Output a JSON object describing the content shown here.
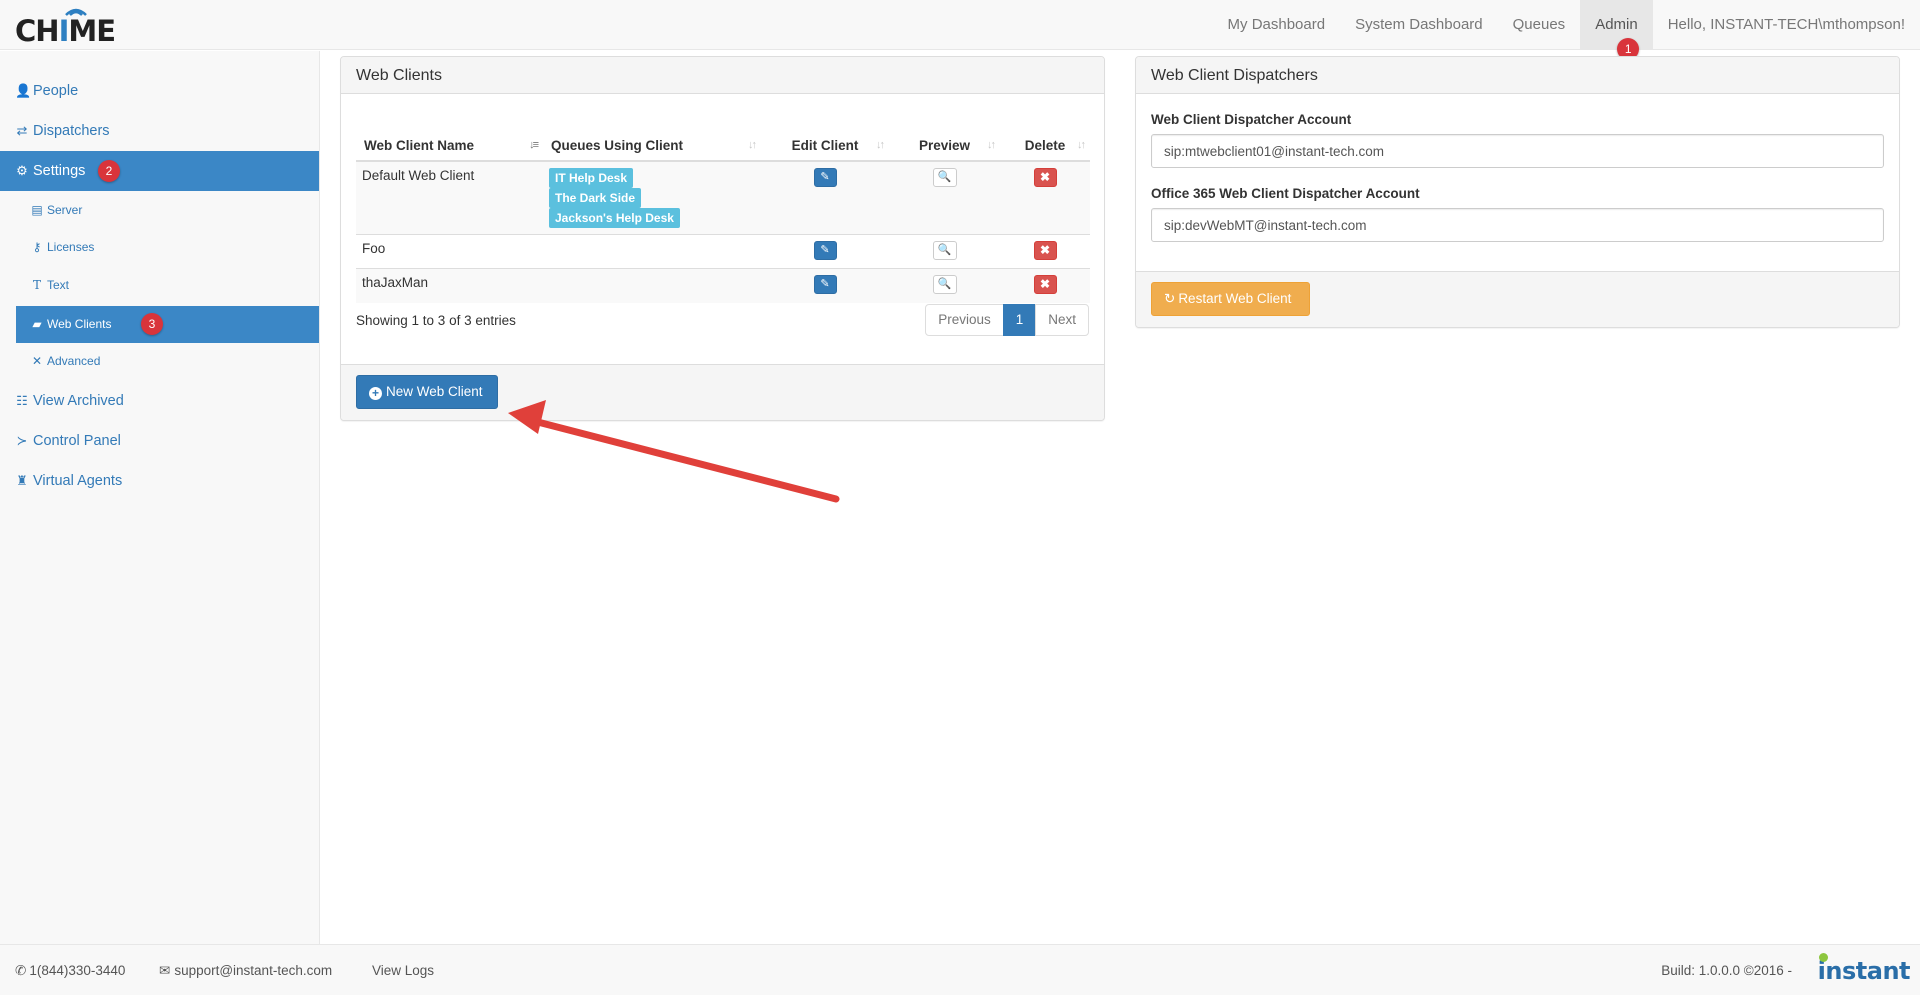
{
  "app": {
    "logo_text": "CHIME",
    "logo_pre": "CH",
    "logo_i": "I",
    "logo_post": "ME"
  },
  "navbar": {
    "links": [
      "My Dashboard",
      "System Dashboard",
      "Queues",
      "Admin"
    ],
    "greeting": "Hello, INSTANT-TECH\\mthompson!",
    "admin_badge": "1"
  },
  "sidebar": {
    "items": [
      {
        "label": "People",
        "icon": "user-icon"
      },
      {
        "label": "Dispatchers",
        "icon": "exchange-icon"
      },
      {
        "label": "Settings",
        "icon": "gear-icon",
        "badge": "2"
      },
      {
        "label": "Server",
        "icon": "server-icon"
      },
      {
        "label": "Licenses",
        "icon": "key-icon"
      },
      {
        "label": "Text",
        "icon": "text-icon"
      },
      {
        "label": "Web Clients",
        "icon": "comment-icon",
        "badge": "3"
      },
      {
        "label": "Advanced",
        "icon": "wrench-icon"
      },
      {
        "label": "View Archived",
        "icon": "archive-icon"
      },
      {
        "label": "Control Panel",
        "icon": "terminal-icon"
      },
      {
        "label": "Virtual Agents",
        "icon": "robot-icon"
      }
    ]
  },
  "web_clients": {
    "title": "Web Clients",
    "columns": [
      "Web Client Name",
      "Queues Using Client",
      "Edit Client",
      "Preview",
      "Delete"
    ],
    "rows": [
      {
        "name": "Default Web Client",
        "queues": [
          "IT Help Desk",
          "The Dark Side",
          "Jackson's Help Desk"
        ]
      },
      {
        "name": "Foo",
        "queues": []
      },
      {
        "name": "thaJaxMan",
        "queues": []
      }
    ],
    "info": "Showing 1 to 3 of 3 entries",
    "pager": {
      "previous": "Previous",
      "current": "1",
      "next": "Next"
    },
    "new_button": "New Web Client"
  },
  "dispatchers": {
    "title": "Web Client Dispatchers",
    "account_label": "Web Client Dispatcher Account",
    "account_value": "sip:mtwebclient01@instant-tech.com",
    "o365_label": "Office 365 Web Client Dispatcher Account",
    "o365_value": "sip:devWebMT@instant-tech.com",
    "restart_button": "Restart Web Client"
  },
  "footer": {
    "phone": "1(844)330-3440",
    "email": "support@instant-tech.com",
    "logs": "View Logs",
    "build": "Build: 1.0.0.0 ©2016 -",
    "brand": "instant"
  },
  "colors": {
    "primary": "#337ab7",
    "sidebar_active": "#3b87c6",
    "label_info": "#5bc0de",
    "danger": "#d9534f",
    "warning": "#f0ad4e",
    "annotation_red": "#e0403a"
  }
}
